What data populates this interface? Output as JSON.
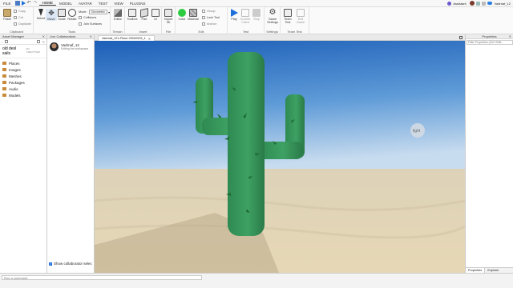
{
  "menu": {
    "items": [
      "FILE",
      "HOME",
      "MODEL",
      "AVATAR",
      "TEST",
      "VIEW",
      "PLUGINS"
    ],
    "active": "HOME",
    "assistant": "Assistant",
    "username": "Vadrnaf_12"
  },
  "ribbon": {
    "clipboard": {
      "paste": "Paste",
      "copy": "Copy",
      "cut": "Cut",
      "duplicate": "Duplicate",
      "label": "Clipboard"
    },
    "tools": {
      "select": "Select",
      "move": "Move",
      "scale": "Scale",
      "rotate": "Rotate",
      "mode_label": "Mode:",
      "mode_value": "Geometric",
      "collisions": "Collisions",
      "join_surfaces": "Join Surfaces",
      "label": "Tools"
    },
    "terrain": {
      "editor": "Editor",
      "label": "Terrain"
    },
    "insert": {
      "toolbox": "Toolbox",
      "part": "Part",
      "ui": "UI",
      "label": "Insert"
    },
    "file": {
      "import3d": "Import 3D",
      "label": "File"
    },
    "edit": {
      "color": "Color",
      "material": "Material",
      "group": "Group",
      "lock": "Lock Tool",
      "anchor": "Anchor",
      "label": "Edit"
    },
    "test": {
      "play": "Play",
      "current_client": "Current Client",
      "stop": "Stop",
      "label": "Test"
    },
    "settings": {
      "game_settings": "Game Settings",
      "label": "Settings"
    },
    "team_test": {
      "team_test": "Team Test",
      "exit_game": "Exit Game",
      "label": "Team Test"
    },
    "colors": {
      "color_swatch": "#2ecc40",
      "play_blue": "#1e6fd9"
    }
  },
  "asset_manager": {
    "title": "Asset Manager",
    "place_name": "old desl sails",
    "place_id": "(ID: 7460277526)",
    "items": [
      "Places",
      "Images",
      "Meshes",
      "Packages",
      "Audio",
      "Models"
    ]
  },
  "collaborators": {
    "title": "Live Collaborators",
    "user": "Vadrnaf_12",
    "status": "Editing the workspace",
    "checkbox_label": "Show collaborator selec"
  },
  "viewport": {
    "tab_label": "Vadrnaf_12's Place 00002025_1",
    "light_label": "light"
  },
  "properties": {
    "title": "Properties",
    "filter_placeholder": "Filter Properties (Ctrl+Shift...",
    "tabs": [
      "Properties",
      "Explorer"
    ]
  },
  "command": {
    "placeholder": "Run a command"
  }
}
